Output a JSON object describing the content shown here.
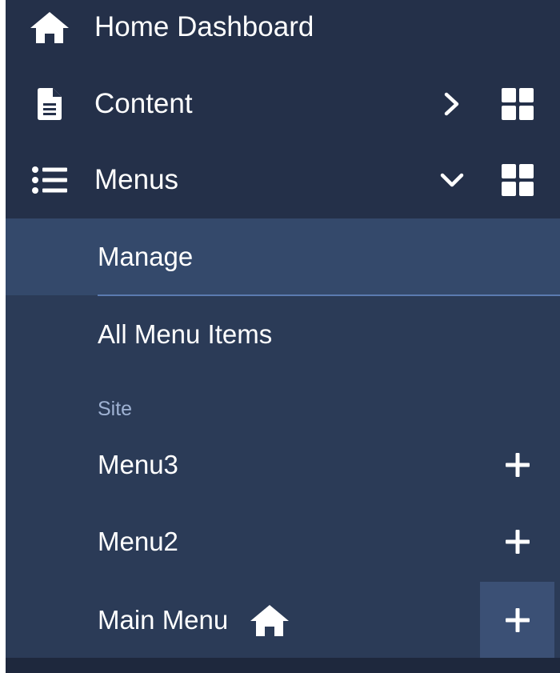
{
  "nav": {
    "home": {
      "label": "Home Dashboard",
      "icon": "home-icon"
    },
    "content": {
      "label": "Content",
      "icon": "document-icon",
      "chevron": "chevron-right-icon",
      "action_icon": "dashboard-grid-icon"
    },
    "menus": {
      "label": "Menus",
      "icon": "list-icon",
      "chevron": "chevron-down-icon",
      "action_icon": "dashboard-grid-icon",
      "expanded": true
    }
  },
  "submenu": {
    "manage": {
      "label": "Manage",
      "active": true
    },
    "all_items": {
      "label": "All Menu Items"
    },
    "section_heading": "Site",
    "menus": [
      {
        "label": "Menu3",
        "add_icon": "plus-icon"
      },
      {
        "label": "Menu2",
        "add_icon": "plus-icon"
      },
      {
        "label": "Main Menu",
        "is_default": true,
        "default_icon": "home-icon",
        "add_icon": "plus-icon"
      }
    ]
  },
  "colors": {
    "sidebar_bg": "#243049",
    "submenu_bg": "#2b3b57",
    "active_bg": "#34496b",
    "accent_line": "#5b7bb0",
    "heading_text": "#9fb2d3",
    "text": "#ffffff"
  }
}
